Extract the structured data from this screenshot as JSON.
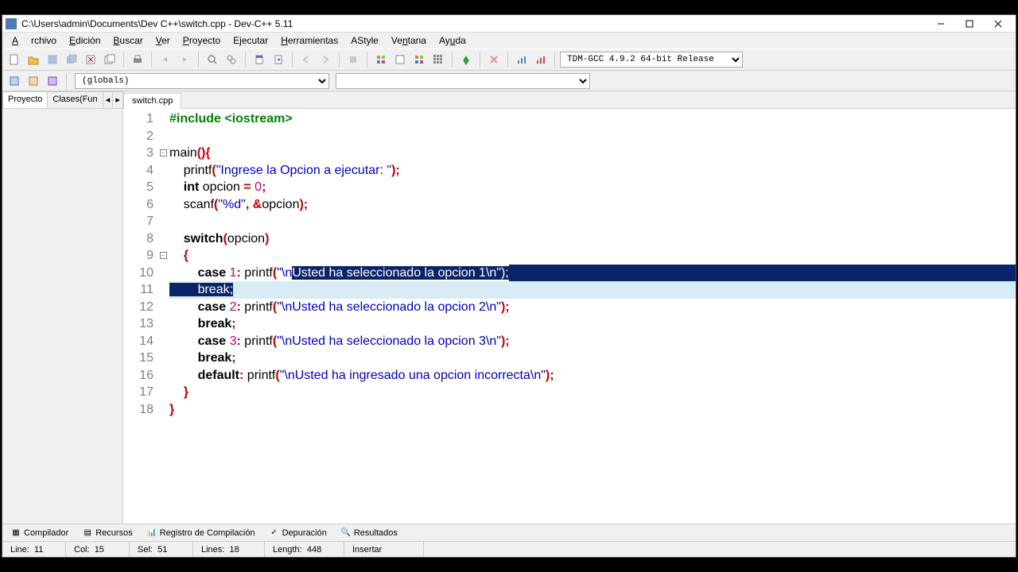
{
  "title": "C:\\Users\\admin\\Documents\\Dev C++\\switch.cpp - Dev-C++ 5.11",
  "menu": [
    "Archivo",
    "Edición",
    "Buscar",
    "Ver",
    "Proyecto",
    "Ejecutar",
    "Herramientas",
    "AStyle",
    "Ventana",
    "Ayuda"
  ],
  "compiler": "TDM-GCC 4.9.2 64-bit Release",
  "globals": "(globals)",
  "sidetabs": {
    "projects": "Proyecto",
    "classes": "Clases(Fun"
  },
  "filetab": "switch.cpp",
  "code": {
    "lines": [
      {
        "n": 1,
        "segs": [
          {
            "t": "#include <iostream>",
            "c": "pp"
          }
        ]
      },
      {
        "n": 2,
        "segs": [
          {
            "t": " "
          }
        ]
      },
      {
        "n": 3,
        "fold": true,
        "segs": [
          {
            "t": "main",
            "c": ""
          },
          {
            "t": "(){",
            "c": "op"
          }
        ]
      },
      {
        "n": 4,
        "segs": [
          {
            "t": "    printf"
          },
          {
            "t": "(",
            "c": "op"
          },
          {
            "t": "\"Ingrese la Opcion a ejecutar: \"",
            "c": "str"
          },
          {
            "t": ");",
            "c": "op"
          }
        ]
      },
      {
        "n": 5,
        "segs": [
          {
            "t": "    "
          },
          {
            "t": "int",
            "c": "kw"
          },
          {
            "t": " opcion "
          },
          {
            "t": "=",
            "c": "op"
          },
          {
            "t": " "
          },
          {
            "t": "0",
            "c": "num"
          },
          {
            "t": ";",
            "c": "op"
          }
        ]
      },
      {
        "n": 6,
        "segs": [
          {
            "t": "    scanf"
          },
          {
            "t": "(",
            "c": "op"
          },
          {
            "t": "\"%d\"",
            "c": "str"
          },
          {
            "t": ",",
            "c": "op"
          },
          {
            "t": " "
          },
          {
            "t": "&",
            "c": "op"
          },
          {
            "t": "opcion"
          },
          {
            "t": ");",
            "c": "op"
          }
        ]
      },
      {
        "n": 7,
        "segs": [
          {
            "t": "    "
          }
        ]
      },
      {
        "n": 8,
        "segs": [
          {
            "t": "    "
          },
          {
            "t": "switch",
            "c": "kw"
          },
          {
            "t": "(",
            "c": "op"
          },
          {
            "t": "opcion"
          },
          {
            "t": ")",
            "c": "op"
          }
        ]
      },
      {
        "n": 9,
        "fold": true,
        "segs": [
          {
            "t": "    "
          },
          {
            "t": "{",
            "c": "op"
          }
        ]
      },
      {
        "n": 10,
        "segs": [
          {
            "t": "        "
          },
          {
            "t": "case",
            "c": "kw"
          },
          {
            "t": " "
          },
          {
            "t": "1",
            "c": "num"
          },
          {
            "t": ":",
            "c": "op"
          },
          {
            "t": " printf"
          },
          {
            "t": "(",
            "c": "op"
          },
          {
            "t": "\"\\n",
            "c": "str"
          },
          {
            "t": "Usted ha seleccionado la opcion 1\\n\");",
            "c": "str",
            "sel": true
          }
        ]
      },
      {
        "n": 11,
        "hl": true,
        "segs": [
          {
            "t": "        break;",
            "sel": true
          }
        ]
      },
      {
        "n": 12,
        "segs": [
          {
            "t": "        "
          },
          {
            "t": "case",
            "c": "kw"
          },
          {
            "t": " "
          },
          {
            "t": "2",
            "c": "num"
          },
          {
            "t": ":",
            "c": "op"
          },
          {
            "t": " printf"
          },
          {
            "t": "(",
            "c": "op"
          },
          {
            "t": "\"\\nUsted ha seleccionado la opcion 2\\n\"",
            "c": "str"
          },
          {
            "t": ");",
            "c": "op"
          }
        ]
      },
      {
        "n": 13,
        "segs": [
          {
            "t": "        "
          },
          {
            "t": "break",
            "c": "kw"
          },
          {
            "t": ";",
            "c": "op"
          }
        ]
      },
      {
        "n": 14,
        "segs": [
          {
            "t": "        "
          },
          {
            "t": "case",
            "c": "kw"
          },
          {
            "t": " "
          },
          {
            "t": "3",
            "c": "num"
          },
          {
            "t": ":",
            "c": "op"
          },
          {
            "t": " printf"
          },
          {
            "t": "(",
            "c": "op"
          },
          {
            "t": "\"\\nUsted ha seleccionado la opcion 3\\n\"",
            "c": "str"
          },
          {
            "t": ");",
            "c": "op"
          }
        ]
      },
      {
        "n": 15,
        "segs": [
          {
            "t": "        "
          },
          {
            "t": "break",
            "c": "kw"
          },
          {
            "t": ";",
            "c": "op"
          }
        ]
      },
      {
        "n": 16,
        "segs": [
          {
            "t": "        "
          },
          {
            "t": "default",
            "c": "kw"
          },
          {
            "t": ":",
            "c": "op"
          },
          {
            "t": " printf"
          },
          {
            "t": "(",
            "c": "op"
          },
          {
            "t": "\"\\nUsted ha ingresado una opcion incorrecta\\n\"",
            "c": "str"
          },
          {
            "t": ");",
            "c": "op"
          }
        ]
      },
      {
        "n": 17,
        "segs": [
          {
            "t": "    "
          },
          {
            "t": "}",
            "c": "op"
          }
        ]
      },
      {
        "n": 18,
        "segs": [
          {
            "t": "}",
            "c": "op"
          }
        ]
      }
    ]
  },
  "bottomtabs": [
    "Compilador",
    "Recursos",
    "Registro de Compilación",
    "Depuración",
    "Resultados"
  ],
  "status": {
    "line_lbl": "Line:",
    "line": "11",
    "col_lbl": "Col:",
    "col": "15",
    "sel_lbl": "Sel:",
    "sel": "51",
    "lines_lbl": "Lines:",
    "lines": "18",
    "len_lbl": "Length:",
    "len": "448",
    "mode": "Insertar"
  }
}
